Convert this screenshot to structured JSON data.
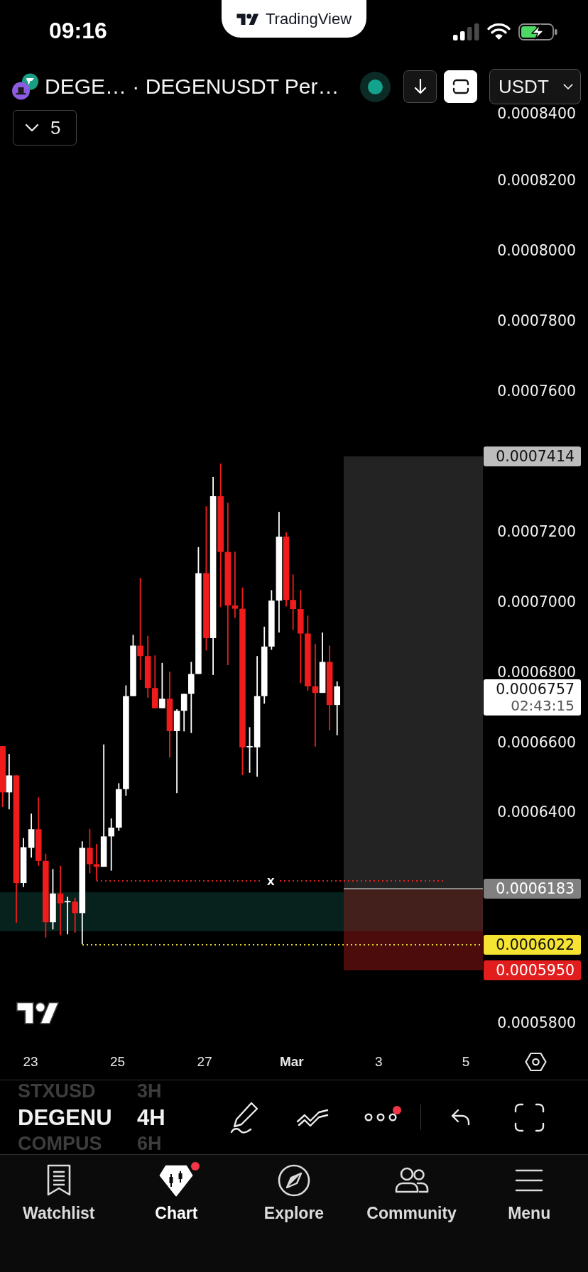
{
  "status_bar": {
    "time": "09:16",
    "app_name": "TradingView"
  },
  "header": {
    "title": "DEGE… · DEGENUSDT Per…",
    "buttons": [
      {
        "kind": "download",
        "selected": false
      },
      {
        "kind": "frame",
        "selected": true
      }
    ],
    "currency": "USDT",
    "indicators_count": "5"
  },
  "chart": {
    "line_label": "x"
  },
  "price_axis": {
    "ticks": [
      "0.0008400",
      "0.0008200",
      "0.0008000",
      "0.0007800",
      "0.0007600",
      "0.0007200",
      "0.0007000",
      "0.0006800",
      "0.0006600",
      "0.0006400",
      "0.0005800"
    ],
    "badges": [
      {
        "price": "0.0007414",
        "color": "#bdbdbd"
      },
      {
        "price": "0.0006757",
        "countdown": "02:43:15",
        "color": "#ffffff"
      },
      {
        "price": "0.0006183",
        "color": "#808080"
      },
      {
        "price": "0.0006022",
        "color": "#f5e431"
      },
      {
        "price": "0.0005950",
        "color": "#e11d1d"
      }
    ]
  },
  "time_axis": [
    {
      "label": "23",
      "kind": "day"
    },
    {
      "label": "25",
      "kind": "day"
    },
    {
      "label": "27",
      "kind": "day"
    },
    {
      "label": "Mar",
      "kind": "month"
    },
    {
      "label": "3",
      "kind": "day"
    },
    {
      "label": "5",
      "kind": "day"
    }
  ],
  "symbol_picker": {
    "symbols": [
      {
        "label": "STXUSD",
        "selected": false
      },
      {
        "label": "DEGENU",
        "selected": true
      },
      {
        "label": "COMPUS",
        "selected": false
      }
    ],
    "intervals": [
      {
        "label": "3H",
        "selected": false
      },
      {
        "label": "4H",
        "selected": true
      },
      {
        "label": "6H",
        "selected": false
      }
    ]
  },
  "toolbar": [
    {
      "kind": "draw",
      "notification": false
    },
    {
      "kind": "trend",
      "notification": false
    },
    {
      "kind": "more",
      "notification": true
    },
    {
      "kind": "undo",
      "notification": false
    },
    {
      "kind": "fullscreen",
      "notification": false
    }
  ],
  "nav": [
    {
      "label": "Watchlist",
      "kind": "watchlist",
      "selected": false,
      "notification": false
    },
    {
      "label": "Chart",
      "kind": "chart",
      "selected": true,
      "notification": true
    },
    {
      "label": "Explore",
      "kind": "explore",
      "selected": false,
      "notification": false
    },
    {
      "label": "Community",
      "kind": "community",
      "selected": false,
      "notification": false
    },
    {
      "label": "Menu",
      "kind": "menu",
      "selected": false,
      "notification": false
    }
  ]
}
